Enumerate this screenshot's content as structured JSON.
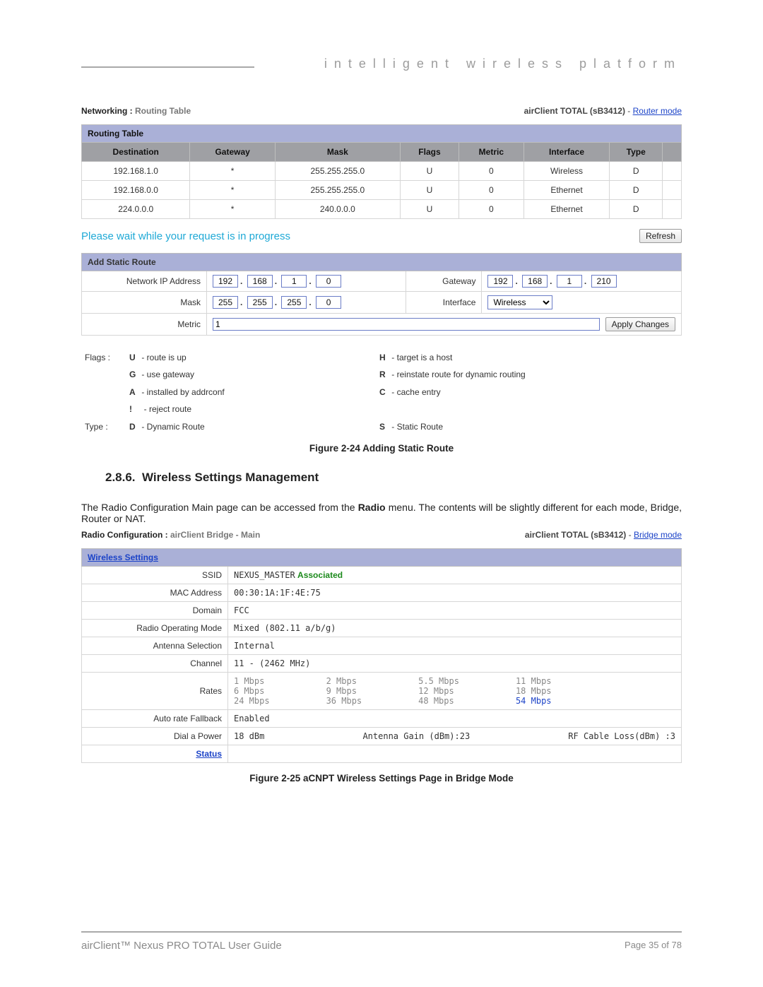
{
  "header": {
    "brand": "intelligent wireless platform"
  },
  "figure1": {
    "breadcrumb_label": "Networking :",
    "breadcrumb_value": "Routing Table",
    "device": "airClient TOTAL (sB3412)",
    "sep": " - ",
    "mode_link": "Router mode",
    "routing_table": {
      "title": "Routing Table",
      "columns": [
        "Destination",
        "Gateway",
        "Mask",
        "Flags",
        "Metric",
        "Interface",
        "Type"
      ],
      "rows": [
        [
          "192.168.1.0",
          "*",
          "255.255.255.0",
          "U",
          "0",
          "Wireless",
          "D"
        ],
        [
          "192.168.0.0",
          "*",
          "255.255.255.0",
          "U",
          "0",
          "Ethernet",
          "D"
        ],
        [
          "224.0.0.0",
          "*",
          "240.0.0.0",
          "U",
          "0",
          "Ethernet",
          "D"
        ]
      ]
    },
    "wait_msg": "Please wait while your request is in progress",
    "refresh": "Refresh",
    "add_route": {
      "title": "Add Static Route",
      "fields": {
        "nip_label": "Network IP Address",
        "nip": [
          "192",
          "168",
          "1",
          "0"
        ],
        "gateway_label": "Gateway",
        "gateway": [
          "192",
          "168",
          "1",
          "210"
        ],
        "mask_label": "Mask",
        "mask": [
          "255",
          "255",
          "255",
          "0"
        ],
        "interface_label": "Interface",
        "interface": "Wireless",
        "metric_label": "Metric",
        "metric": "1",
        "apply": "Apply Changes"
      }
    },
    "legend": {
      "flags_label": "Flags :",
      "type_label": "Type :",
      "U": "route is up",
      "H": "target is a host",
      "G": "use gateway",
      "R": "reinstate route for dynamic routing",
      "A": "installed by addrconf",
      "C": "cache entry",
      "excl": "reject route",
      "D": "Dynamic Route",
      "S": "Static Route"
    },
    "caption": "Figure 2-24 Adding Static Route"
  },
  "section": {
    "number": "2.8.6.",
    "title": "Wireless Settings Management",
    "text_pre": "The Radio Configuration Main page can be accessed from the ",
    "text_bold": "Radio",
    "text_post": " menu. The contents will be slightly different for each mode, Bridge, Router or NAT."
  },
  "figure2": {
    "breadcrumb_label": "Radio Configuration :",
    "breadcrumb_value": "airClient Bridge - Main",
    "device": "airClient TOTAL (sB3412)",
    "sep": " - ",
    "mode_link": "Bridge mode",
    "table_title": "Wireless Settings",
    "rows": {
      "ssid_label": "SSID",
      "ssid_val": "NEXUS_MASTER",
      "ssid_assoc": "Associated",
      "mac_label": "MAC Address",
      "mac_val": "00:30:1A:1F:4E:75",
      "domain_label": "Domain",
      "domain_val": "FCC",
      "rom_label": "Radio Operating Mode",
      "rom_val": "Mixed (802.11 a/b/g)",
      "ant_label": "Antenna Selection",
      "ant_val": "Internal",
      "chan_label": "Channel",
      "chan_val": "11 - (2462 MHz)",
      "rates_label": "Rates",
      "rates": {
        "c1": [
          "1 Mbps",
          "6 Mbps",
          "24 Mbps"
        ],
        "c2": [
          "2 Mbps",
          "9 Mbps",
          "36 Mbps"
        ],
        "c3": [
          "5.5 Mbps",
          "12 Mbps",
          "48 Mbps"
        ],
        "c4": [
          "11 Mbps",
          "18 Mbps",
          "54 Mbps"
        ]
      },
      "arf_label": "Auto rate Fallback",
      "arf_val": "Enabled",
      "dial_label": "Dial a Power",
      "dial_val1": "18 dBm",
      "dial_val2": "Antenna Gain (dBm):23",
      "dial_val3": "RF Cable Loss(dBm) :3",
      "status": "Status"
    },
    "caption": "Figure 2-25 aCNPT Wireless Settings Page in Bridge Mode"
  },
  "footer": {
    "guide": "airClient™ Nexus PRO TOTAL User Guide",
    "page": "Page 35 of 78"
  }
}
